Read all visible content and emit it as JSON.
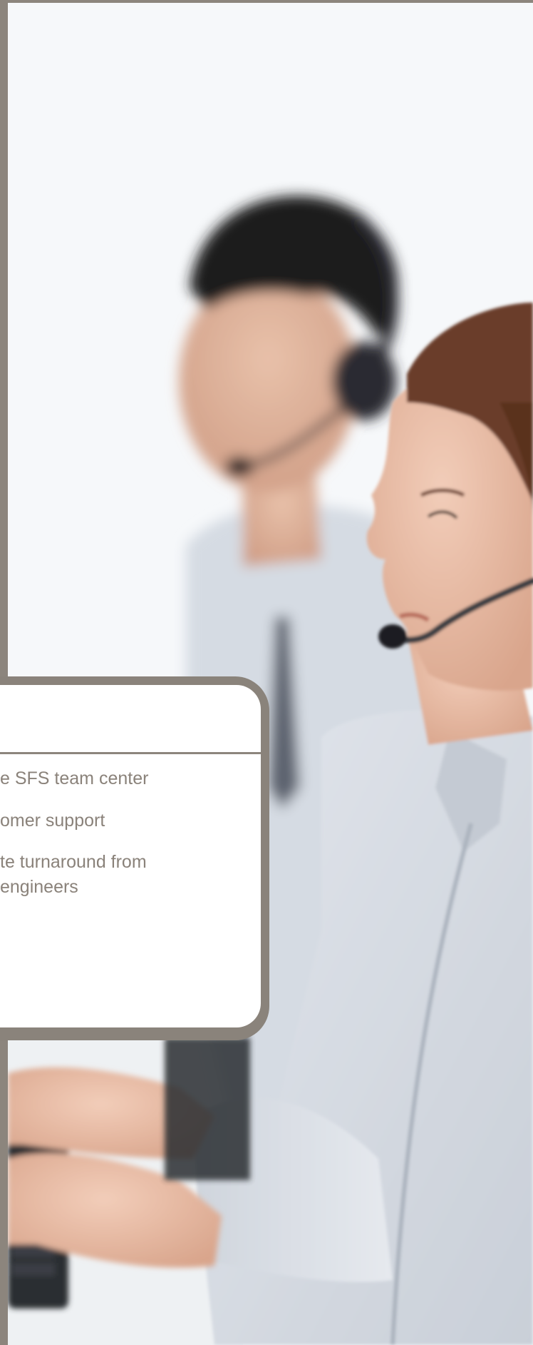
{
  "card": {
    "items": [
      {
        "text": "e SFS team center"
      },
      {
        "text": "omer support"
      },
      {
        "text": "te turnaround from\nengineers"
      }
    ]
  },
  "photo": {
    "subject": "customer-support-agents-with-headsets",
    "colors": {
      "background": "#f5f7f9",
      "shirt": "#d9dee6",
      "hair_man": "#1f1b1a",
      "hair_woman": "#6a3e2c",
      "skin": "#e6b9a2",
      "border": "#8c857d"
    }
  }
}
